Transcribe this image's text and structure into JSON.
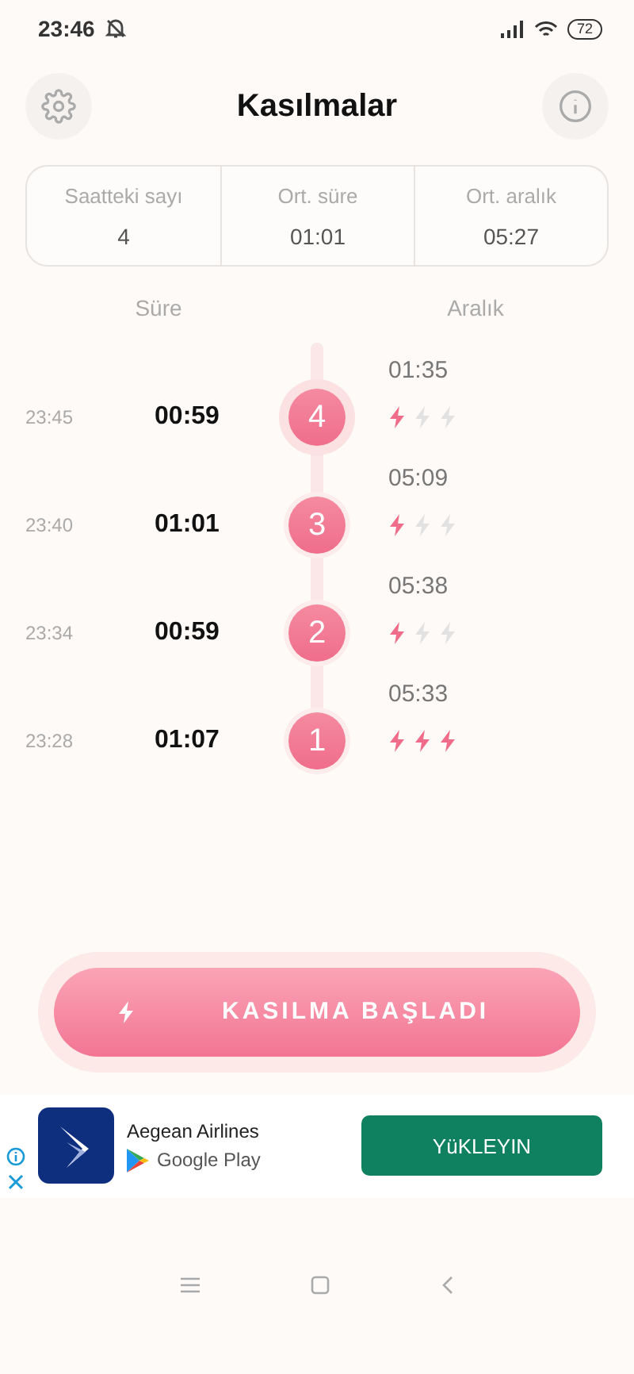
{
  "status_bar": {
    "time": "23:46",
    "battery": "72"
  },
  "header": {
    "title": "Kasılmalar"
  },
  "stats": [
    {
      "label": "Saatteki sayı",
      "value": "4"
    },
    {
      "label": "Ort. süre",
      "value": "01:01"
    },
    {
      "label": "Ort. aralık",
      "value": "05:27"
    }
  ],
  "columns": {
    "duration": "Süre",
    "interval": "Aralık"
  },
  "contractions": [
    {
      "interval": "01:35",
      "time": "23:45",
      "duration": "00:59",
      "number": "4",
      "stars": 1,
      "selected": true
    },
    {
      "interval": "05:09",
      "time": "23:40",
      "duration": "01:01",
      "number": "3",
      "stars": 1,
      "selected": false
    },
    {
      "interval": "05:38",
      "time": "23:34",
      "duration": "00:59",
      "number": "2",
      "stars": 1,
      "selected": false
    },
    {
      "interval": "05:33",
      "time": "23:28",
      "duration": "01:07",
      "number": "1",
      "stars": 3,
      "selected": false
    }
  ],
  "start_button": {
    "label": "KASILMA BAŞLADI"
  },
  "ad": {
    "name": "Aegean Airlines",
    "store": "Google Play",
    "button": "YüKLEYIN"
  }
}
